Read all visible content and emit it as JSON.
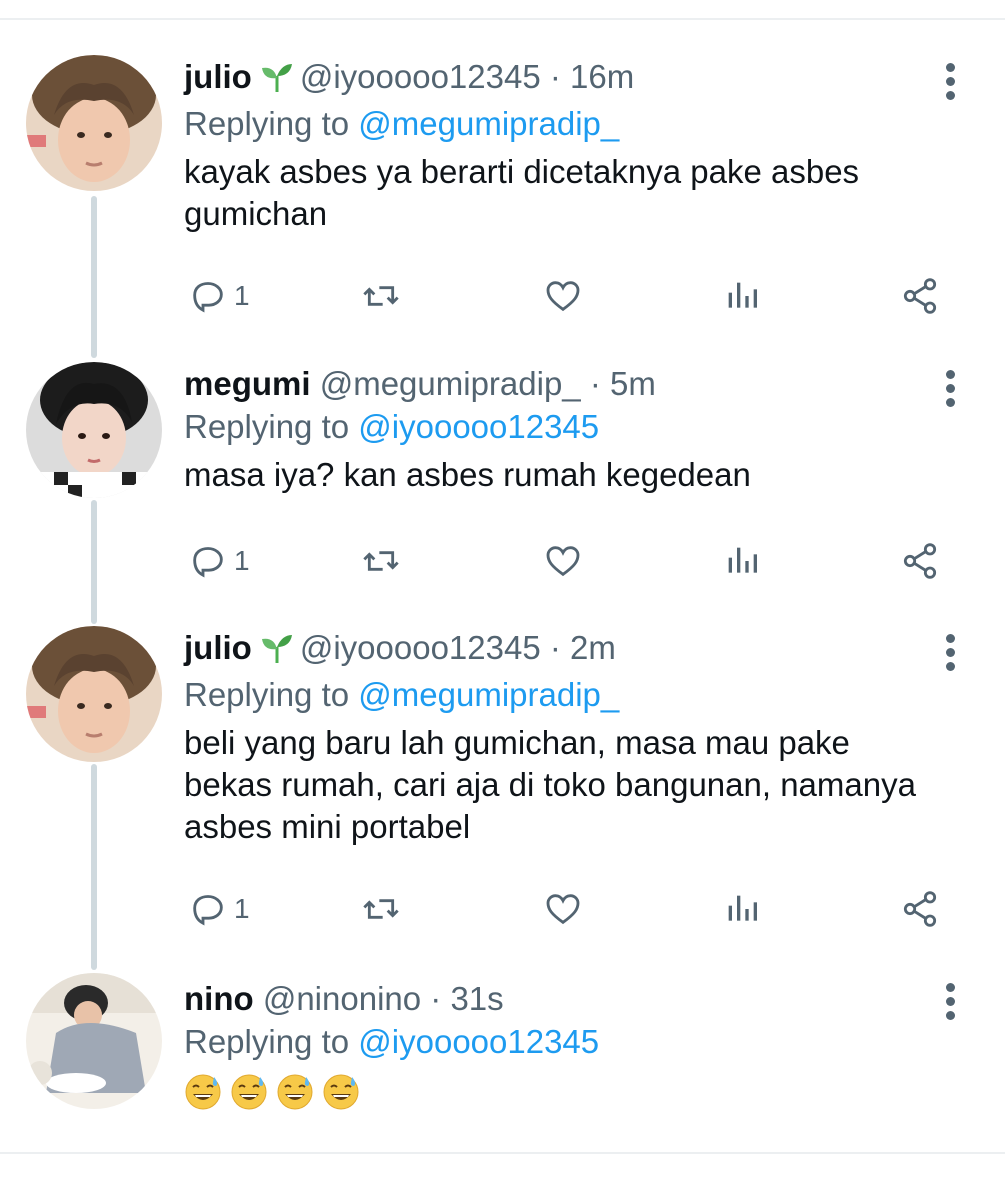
{
  "tweets": [
    {
      "name": "julio",
      "has_leaf_emoji": true,
      "handle": "@iyooooo12345",
      "time": "· 16m",
      "replying_prefix": "Replying to",
      "replying_to": "@megumipradip_",
      "text": "kayak asbes ya berarti dicetaknya pake asbes gumichan",
      "reply_count": "1"
    },
    {
      "name": "megumi",
      "has_leaf_emoji": false,
      "handle": "@megumipradip_",
      "time": "· 5m",
      "replying_prefix": "Replying to",
      "replying_to": "@iyooooo12345",
      "text": "masa iya? kan asbes rumah kegedean",
      "reply_count": "1"
    },
    {
      "name": "julio",
      "has_leaf_emoji": true,
      "handle": "@iyooooo12345",
      "time": "· 2m",
      "replying_prefix": "Replying to",
      "replying_to": "@megumipradip_",
      "text": "beli yang baru lah gumichan, masa mau pake bekas rumah, cari aja di toko bangunan, namanya asbes mini portabel",
      "reply_count": "1"
    },
    {
      "name": "nino",
      "has_leaf_emoji": false,
      "handle": "@ninonino",
      "time": "· 31s",
      "replying_prefix": "Replying to",
      "replying_to": "@iyooooo12345",
      "emoji_text": "😅😅😅😅"
    }
  ],
  "icons": {
    "reply": "reply-icon",
    "retweet": "retweet-icon",
    "like": "heart-icon",
    "analytics": "analytics-icon",
    "share": "share-icon",
    "more": "more-vertical-icon"
  },
  "colors": {
    "mention": "#1d9bf0",
    "secondary_text": "#536471",
    "thread_line": "#cfd9de",
    "leaf": "#4caf50"
  }
}
